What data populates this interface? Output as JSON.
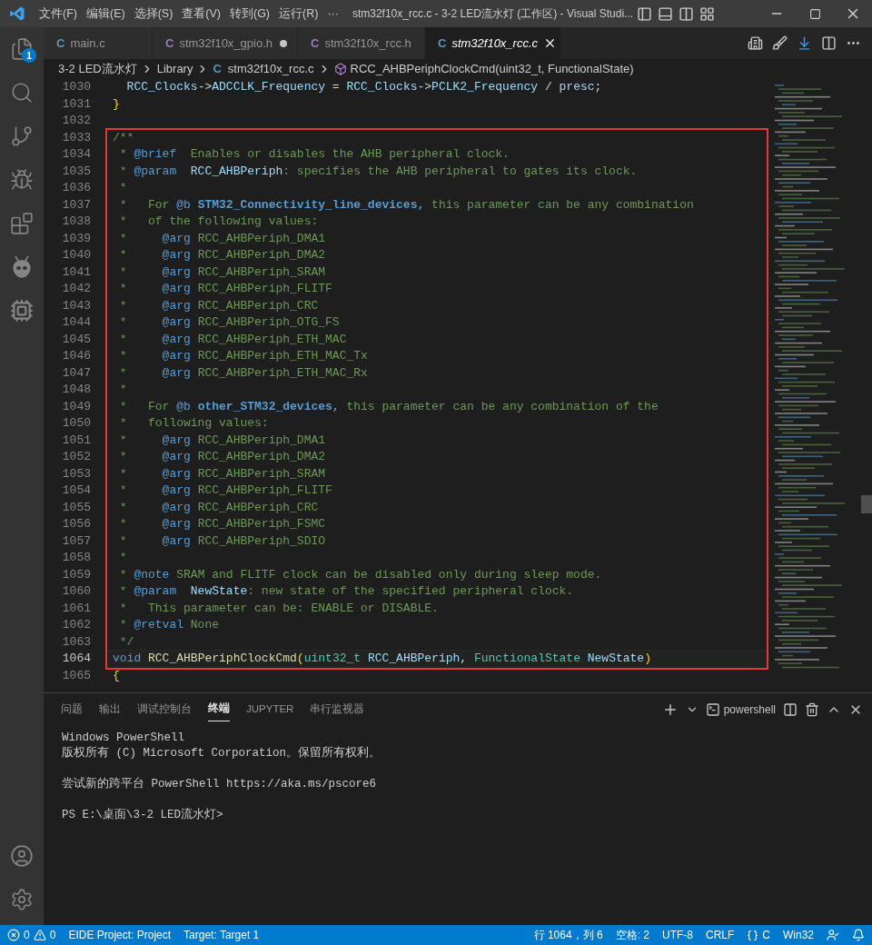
{
  "window": {
    "menu": [
      "文件(F)",
      "编辑(E)",
      "选择(S)",
      "查看(V)",
      "转到(G)",
      "运行(R)",
      "···"
    ],
    "title": "stm32f10x_rcc.c - 3-2 LED流水灯 (工作区) - Visual Studi..."
  },
  "activity_bar": {
    "explorer_badge": "1"
  },
  "tabs": [
    {
      "label": "main.c",
      "icon_text": "C",
      "kind": "c",
      "selected": false,
      "modified": false
    },
    {
      "label": "stm32f10x_gpio.h",
      "icon_text": "C",
      "kind": "h",
      "selected": false,
      "modified": true
    },
    {
      "label": "stm32f10x_rcc.h",
      "icon_text": "C",
      "kind": "h",
      "selected": false,
      "modified": false
    },
    {
      "label": "stm32f10x_rcc.c",
      "icon_text": "C",
      "kind": "c",
      "selected": true,
      "modified": false
    }
  ],
  "breadcrumb": [
    {
      "label": "3-2 LED流水灯",
      "kind": "folder"
    },
    {
      "label": "Library",
      "kind": "folder"
    },
    {
      "label": "stm32f10x_rcc.c",
      "kind": "file",
      "icon_text": "C"
    },
    {
      "label": "RCC_AHBPeriphClockCmd(uint32_t, FunctionalState)",
      "kind": "symbol"
    }
  ],
  "code": {
    "lines_before": [
      {
        "number": "1030",
        "current": false,
        "segments": [
          {
            "kind": "p",
            "text": "  RCC_Clocks"
          },
          {
            "kind": "x",
            "text": "->"
          },
          {
            "kind": "p",
            "text": "ADCCLK_Frequency"
          },
          {
            "kind": "x",
            "text": " = "
          },
          {
            "kind": "p",
            "text": "RCC_Clocks"
          },
          {
            "kind": "x",
            "text": "->"
          },
          {
            "kind": "p",
            "text": "PCLK2_Frequency"
          },
          {
            "kind": "x",
            "text": " / "
          },
          {
            "kind": "p",
            "text": "presc"
          },
          {
            "kind": "x",
            "text": ";"
          }
        ]
      },
      {
        "number": "1031",
        "current": false,
        "segments": [
          {
            "kind": "br",
            "text": "}"
          }
        ]
      },
      {
        "number": "1032",
        "current": false
      }
    ],
    "highlighted_block": {
      "lines": [
        {
          "number": "1033",
          "current": false,
          "segments": [
            {
              "kind": "c",
              "text": "/**"
            }
          ]
        },
        {
          "number": "1034",
          "current": false,
          "segments": [
            {
              "kind": "c",
              "text": " * "
            },
            {
              "kind": "t",
              "text": "@brief"
            },
            {
              "kind": "c",
              "text": "  Enables or disables the AHB peripheral clock."
            }
          ]
        },
        {
          "number": "1035",
          "current": false,
          "segments": [
            {
              "kind": "c",
              "text": " * "
            },
            {
              "kind": "t",
              "text": "@param"
            },
            {
              "kind": "p",
              "text": "  RCC_AHBPeriph"
            },
            {
              "kind": "c",
              "text": ": specifies the AHB peripheral to gates its clock."
            }
          ]
        },
        {
          "number": "1036",
          "current": false,
          "segments": [
            {
              "kind": "c",
              "text": " *"
            }
          ]
        },
        {
          "number": "1037",
          "current": false,
          "segments": [
            {
              "kind": "c",
              "text": " *   For "
            },
            {
              "kind": "t",
              "text": "@b"
            },
            {
              "kind": "b",
              "text": " STM32_Connectivity_line_devices,"
            },
            {
              "kind": "c",
              "text": " this parameter can be any combination"
            }
          ]
        },
        {
          "number": "1038",
          "current": false,
          "segments": [
            {
              "kind": "c",
              "text": " *   of the following values:"
            }
          ]
        },
        {
          "number": "1039",
          "current": false,
          "segments": [
            {
              "kind": "c",
              "text": " *     "
            },
            {
              "kind": "t",
              "text": "@arg"
            },
            {
              "kind": "c",
              "text": " RCC_AHBPeriph_DMA1"
            }
          ]
        },
        {
          "number": "1040",
          "current": false,
          "segments": [
            {
              "kind": "c",
              "text": " *     "
            },
            {
              "kind": "t",
              "text": "@arg"
            },
            {
              "kind": "c",
              "text": " RCC_AHBPeriph_DMA2"
            }
          ]
        },
        {
          "number": "1041",
          "current": false,
          "segments": [
            {
              "kind": "c",
              "text": " *     "
            },
            {
              "kind": "t",
              "text": "@arg"
            },
            {
              "kind": "c",
              "text": " RCC_AHBPeriph_SRAM"
            }
          ]
        },
        {
          "number": "1042",
          "current": false,
          "segments": [
            {
              "kind": "c",
              "text": " *     "
            },
            {
              "kind": "t",
              "text": "@arg"
            },
            {
              "kind": "c",
              "text": " RCC_AHBPeriph_FLITF"
            }
          ]
        },
        {
          "number": "1043",
          "current": false,
          "segments": [
            {
              "kind": "c",
              "text": " *     "
            },
            {
              "kind": "t",
              "text": "@arg"
            },
            {
              "kind": "c",
              "text": " RCC_AHBPeriph_CRC"
            }
          ]
        },
        {
          "number": "1044",
          "current": false,
          "segments": [
            {
              "kind": "c",
              "text": " *     "
            },
            {
              "kind": "t",
              "text": "@arg"
            },
            {
              "kind": "c",
              "text": " RCC_AHBPeriph_OTG_FS"
            }
          ]
        },
        {
          "number": "1045",
          "current": false,
          "segments": [
            {
              "kind": "c",
              "text": " *     "
            },
            {
              "kind": "t",
              "text": "@arg"
            },
            {
              "kind": "c",
              "text": " RCC_AHBPeriph_ETH_MAC"
            }
          ]
        },
        {
          "number": "1046",
          "current": false,
          "segments": [
            {
              "kind": "c",
              "text": " *     "
            },
            {
              "kind": "t",
              "text": "@arg"
            },
            {
              "kind": "c",
              "text": " RCC_AHBPeriph_ETH_MAC_Tx"
            }
          ]
        },
        {
          "number": "1047",
          "current": false,
          "segments": [
            {
              "kind": "c",
              "text": " *     "
            },
            {
              "kind": "t",
              "text": "@arg"
            },
            {
              "kind": "c",
              "text": " RCC_AHBPeriph_ETH_MAC_Rx"
            }
          ]
        },
        {
          "number": "1048",
          "current": false,
          "segments": [
            {
              "kind": "c",
              "text": " *"
            }
          ]
        },
        {
          "number": "1049",
          "current": false,
          "segments": [
            {
              "kind": "c",
              "text": " *   For "
            },
            {
              "kind": "t",
              "text": "@b"
            },
            {
              "kind": "b",
              "text": " other_STM32_devices,"
            },
            {
              "kind": "c",
              "text": " this parameter can be any combination of the"
            }
          ]
        },
        {
          "number": "1050",
          "current": false,
          "segments": [
            {
              "kind": "c",
              "text": " *   following values:"
            }
          ]
        },
        {
          "number": "1051",
          "current": false,
          "segments": [
            {
              "kind": "c",
              "text": " *     "
            },
            {
              "kind": "t",
              "text": "@arg"
            },
            {
              "kind": "c",
              "text": " RCC_AHBPeriph_DMA1"
            }
          ]
        },
        {
          "number": "1052",
          "current": false,
          "segments": [
            {
              "kind": "c",
              "text": " *     "
            },
            {
              "kind": "t",
              "text": "@arg"
            },
            {
              "kind": "c",
              "text": " RCC_AHBPeriph_DMA2"
            }
          ]
        },
        {
          "number": "1053",
          "current": false,
          "segments": [
            {
              "kind": "c",
              "text": " *     "
            },
            {
              "kind": "t",
              "text": "@arg"
            },
            {
              "kind": "c",
              "text": " RCC_AHBPeriph_SRAM"
            }
          ]
        },
        {
          "number": "1054",
          "current": false,
          "segments": [
            {
              "kind": "c",
              "text": " *     "
            },
            {
              "kind": "t",
              "text": "@arg"
            },
            {
              "kind": "c",
              "text": " RCC_AHBPeriph_FLITF"
            }
          ]
        },
        {
          "number": "1055",
          "current": false,
          "segments": [
            {
              "kind": "c",
              "text": " *     "
            },
            {
              "kind": "t",
              "text": "@arg"
            },
            {
              "kind": "c",
              "text": " RCC_AHBPeriph_CRC"
            }
          ]
        },
        {
          "number": "1056",
          "current": false,
          "segments": [
            {
              "kind": "c",
              "text": " *     "
            },
            {
              "kind": "t",
              "text": "@arg"
            },
            {
              "kind": "c",
              "text": " RCC_AHBPeriph_FSMC"
            }
          ]
        },
        {
          "number": "1057",
          "current": false,
          "segments": [
            {
              "kind": "c",
              "text": " *     "
            },
            {
              "kind": "t",
              "text": "@arg"
            },
            {
              "kind": "c",
              "text": " RCC_AHBPeriph_SDIO"
            }
          ]
        },
        {
          "number": "1058",
          "current": false,
          "segments": [
            {
              "kind": "c",
              "text": " *"
            }
          ]
        },
        {
          "number": "1059",
          "current": false,
          "segments": [
            {
              "kind": "c",
              "text": " * "
            },
            {
              "kind": "t",
              "text": "@note"
            },
            {
              "kind": "c",
              "text": " SRAM and FLITF clock can be disabled only during sleep mode."
            }
          ]
        },
        {
          "number": "1060",
          "current": false,
          "segments": [
            {
              "kind": "c",
              "text": " * "
            },
            {
              "kind": "t",
              "text": "@param"
            },
            {
              "kind": "p",
              "text": "  NewState"
            },
            {
              "kind": "c",
              "text": ": new state of the specified peripheral clock."
            }
          ]
        },
        {
          "number": "1061",
          "current": false,
          "segments": [
            {
              "kind": "c",
              "text": " *   This parameter can be: ENABLE or DISABLE."
            }
          ]
        },
        {
          "number": "1062",
          "current": false,
          "segments": [
            {
              "kind": "c",
              "text": " * "
            },
            {
              "kind": "t",
              "text": "@retval"
            },
            {
              "kind": "c",
              "text": " None"
            }
          ]
        },
        {
          "number": "1063",
          "current": false,
          "segments": [
            {
              "kind": "c",
              "text": " */"
            }
          ]
        },
        {
          "number": "1064",
          "current": true,
          "segments": [
            {
              "kind": "k",
              "text": "void"
            },
            {
              "kind": "f",
              "text": " RCC_AHBPeriphClockCmd"
            },
            {
              "kind": "br",
              "text": "("
            },
            {
              "kind": "y",
              "text": "uint32_t"
            },
            {
              "kind": "p",
              "text": " RCC_AHBPeriph"
            },
            {
              "kind": "x",
              "text": ", "
            },
            {
              "kind": "y",
              "text": "FunctionalState"
            },
            {
              "kind": "p",
              "text": " NewState"
            },
            {
              "kind": "br",
              "text": ")"
            }
          ]
        }
      ]
    },
    "lines_after": [
      {
        "number": "1065",
        "current": false,
        "segments": [
          {
            "kind": "br",
            "text": "{"
          }
        ]
      }
    ]
  },
  "panel": {
    "tabs": [
      {
        "label": "问题",
        "selected": false
      },
      {
        "label": "输出",
        "selected": false
      },
      {
        "label": "调试控制台",
        "selected": false
      },
      {
        "label": "终端",
        "selected": true
      },
      {
        "label": "JUPYTER",
        "selected": false
      },
      {
        "label": "串行监视器",
        "selected": false
      }
    ],
    "shell": "powershell",
    "terminal": [
      {
        "lines": [
          "Windows PowerShell",
          "版权所有 (C) Microsoft Corporation。保留所有权利。"
        ]
      },
      {
        "lines": [
          "尝试新的跨平台 PowerShell https://aka.ms/pscore6"
        ]
      },
      {
        "lines": [
          "PS E:\\桌面\\3-2 LED流水灯>"
        ]
      }
    ]
  },
  "status_bar": {
    "errors": "0",
    "warnings": "0",
    "left": [
      "EIDE Project: Project",
      "Target: Target 1"
    ],
    "right": [
      "行 1064，列 6",
      "空格: 2",
      "UTF-8",
      "CRLF"
    ],
    "language": "C",
    "platform": "Win32"
  }
}
